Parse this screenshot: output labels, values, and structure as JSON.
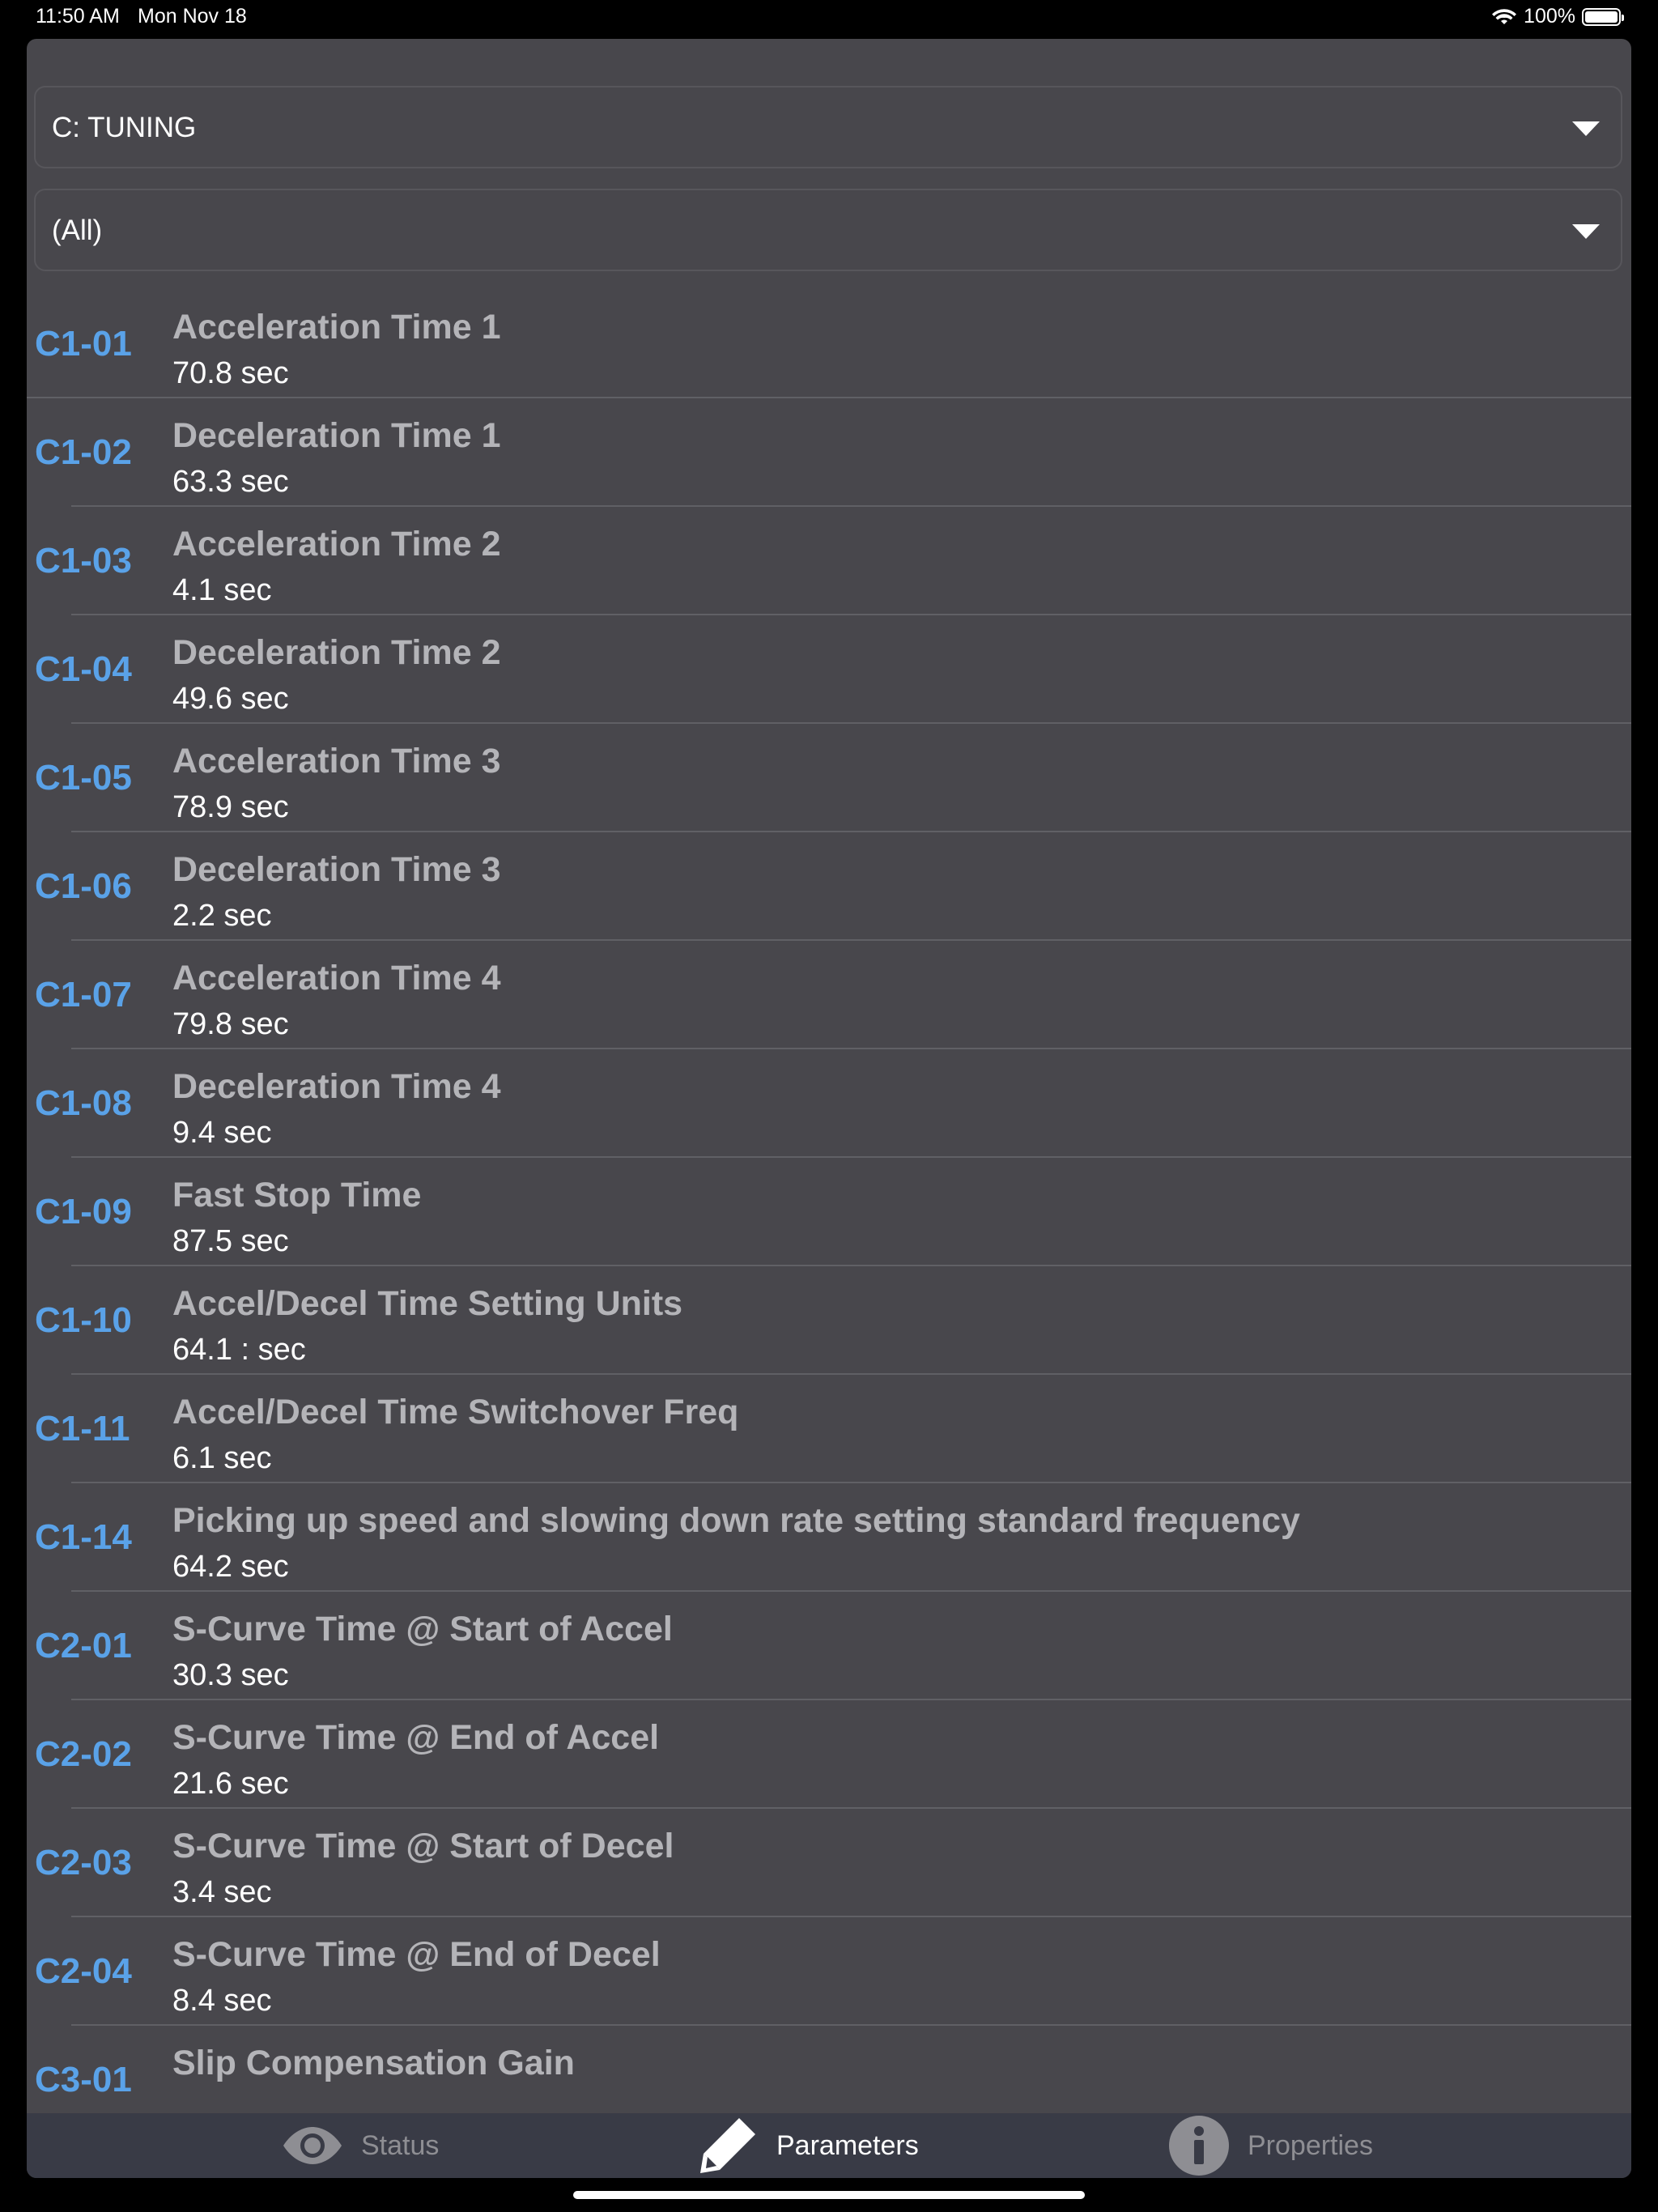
{
  "status_bar": {
    "time": "11:50 AM",
    "date": "Mon Nov 18",
    "battery": "100%",
    "battery_level": 1.0
  },
  "filters": {
    "category": "C: TUNING",
    "subcategory": "(All)"
  },
  "parameters": [
    {
      "code": "C1-01",
      "name": "Acceleration Time 1",
      "value": "70.8 sec"
    },
    {
      "code": "C1-02",
      "name": "Deceleration Time 1",
      "value": "63.3 sec"
    },
    {
      "code": "C1-03",
      "name": "Acceleration Time 2",
      "value": "4.1 sec"
    },
    {
      "code": "C1-04",
      "name": "Deceleration Time 2",
      "value": "49.6 sec"
    },
    {
      "code": "C1-05",
      "name": "Acceleration Time 3",
      "value": "78.9 sec"
    },
    {
      "code": "C1-06",
      "name": "Deceleration Time 3",
      "value": "2.2 sec"
    },
    {
      "code": "C1-07",
      "name": "Acceleration Time 4",
      "value": "79.8 sec"
    },
    {
      "code": "C1-08",
      "name": "Deceleration Time 4",
      "value": "9.4 sec"
    },
    {
      "code": "C1-09",
      "name": "Fast Stop Time",
      "value": "87.5 sec"
    },
    {
      "code": "C1-10",
      "name": "Accel/Decel Time Setting Units",
      "value": "64.1 :  sec"
    },
    {
      "code": "C1-11",
      "name": "Accel/Decel Time Switchover Freq",
      "value": "6.1 sec"
    },
    {
      "code": "C1-14",
      "name": "Picking up speed and slowing down rate setting standard frequency",
      "value": "64.2 sec"
    },
    {
      "code": "C2-01",
      "name": "S-Curve Time @ Start of Accel",
      "value": "30.3 sec"
    },
    {
      "code": "C2-02",
      "name": "S-Curve Time @ End of Accel",
      "value": "21.6 sec"
    },
    {
      "code": "C2-03",
      "name": "S-Curve Time @ Start of Decel",
      "value": "3.4 sec"
    },
    {
      "code": "C2-04",
      "name": "S-Curve Time @ End of Decel",
      "value": "8.4 sec"
    },
    {
      "code": "C3-01",
      "name": "Slip Compensation Gain",
      "value": ""
    }
  ],
  "tabs": {
    "status": {
      "label": "Status",
      "icon": "eye-icon"
    },
    "parameters": {
      "label": "Parameters",
      "icon": "pencil-icon"
    },
    "properties": {
      "label": "Properties",
      "icon": "info-icon"
    }
  },
  "colors": {
    "background": "#48474c",
    "code": "#5aa2e8",
    "name": "#b4b4b8",
    "value": "#ffffff",
    "tabbar": "#393b46",
    "tab_active": "#ffffff",
    "tab_inactive": "#8e8e93"
  }
}
